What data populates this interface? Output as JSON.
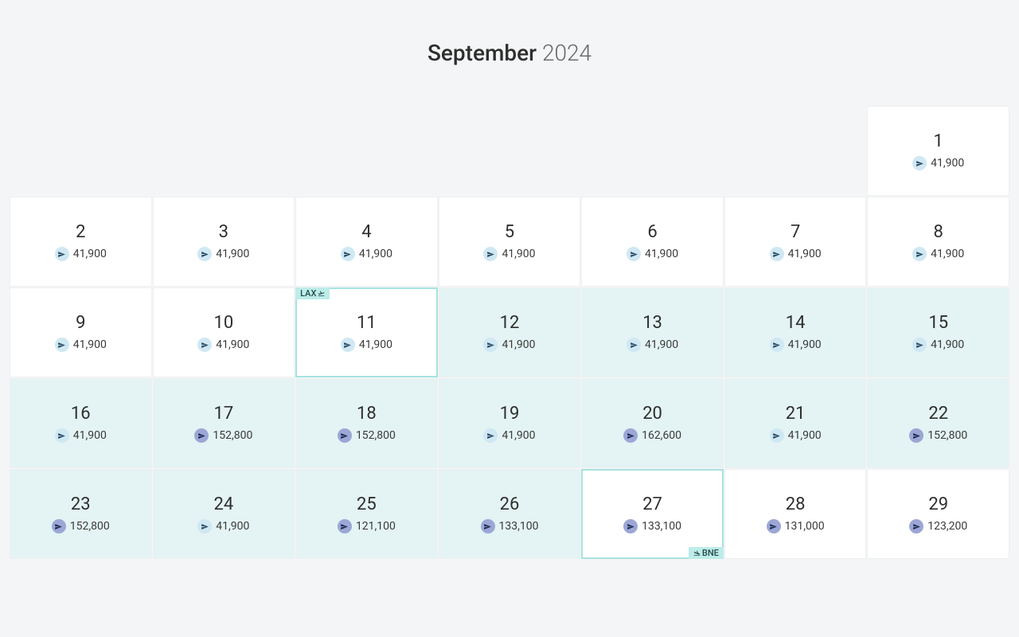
{
  "calendar": {
    "month": "September",
    "year": "2024",
    "departure_tag": "LAX",
    "arrival_tag": "BNE",
    "days": [
      {
        "empty": true
      },
      {
        "empty": true
      },
      {
        "empty": true
      },
      {
        "empty": true
      },
      {
        "empty": true
      },
      {
        "empty": true
      },
      {
        "day": "1",
        "price": "41,900",
        "tier": "low"
      },
      {
        "day": "2",
        "price": "41,900",
        "tier": "low"
      },
      {
        "day": "3",
        "price": "41,900",
        "tier": "low"
      },
      {
        "day": "4",
        "price": "41,900",
        "tier": "low"
      },
      {
        "day": "5",
        "price": "41,900",
        "tier": "low"
      },
      {
        "day": "6",
        "price": "41,900",
        "tier": "low"
      },
      {
        "day": "7",
        "price": "41,900",
        "tier": "low"
      },
      {
        "day": "8",
        "price": "41,900",
        "tier": "low"
      },
      {
        "day": "9",
        "price": "41,900",
        "tier": "low"
      },
      {
        "day": "10",
        "price": "41,900",
        "tier": "low"
      },
      {
        "day": "11",
        "price": "41,900",
        "tier": "low",
        "sel_start": true,
        "tag_top": true
      },
      {
        "day": "12",
        "price": "41,900",
        "tier": "low",
        "tinted": true
      },
      {
        "day": "13",
        "price": "41,900",
        "tier": "low",
        "tinted": true
      },
      {
        "day": "14",
        "price": "41,900",
        "tier": "low",
        "tinted": true
      },
      {
        "day": "15",
        "price": "41,900",
        "tier": "low",
        "tinted": true
      },
      {
        "day": "16",
        "price": "41,900",
        "tier": "low",
        "tinted": true
      },
      {
        "day": "17",
        "price": "152,800",
        "tier": "high",
        "tinted": true
      },
      {
        "day": "18",
        "price": "152,800",
        "tier": "high",
        "tinted": true
      },
      {
        "day": "19",
        "price": "41,900",
        "tier": "low",
        "tinted": true
      },
      {
        "day": "20",
        "price": "162,600",
        "tier": "high",
        "tinted": true
      },
      {
        "day": "21",
        "price": "41,900",
        "tier": "low",
        "tinted": true
      },
      {
        "day": "22",
        "price": "152,800",
        "tier": "high",
        "tinted": true
      },
      {
        "day": "23",
        "price": "152,800",
        "tier": "high",
        "tinted": true
      },
      {
        "day": "24",
        "price": "41,900",
        "tier": "low",
        "tinted": true
      },
      {
        "day": "25",
        "price": "121,100",
        "tier": "high",
        "tinted": true
      },
      {
        "day": "26",
        "price": "133,100",
        "tier": "high",
        "tinted": true
      },
      {
        "day": "27",
        "price": "133,100",
        "tier": "high",
        "sel_end": true,
        "tag_bottom": true
      },
      {
        "day": "28",
        "price": "131,000",
        "tier": "high"
      },
      {
        "day": "29",
        "price": "123,200",
        "tier": "high"
      }
    ]
  }
}
